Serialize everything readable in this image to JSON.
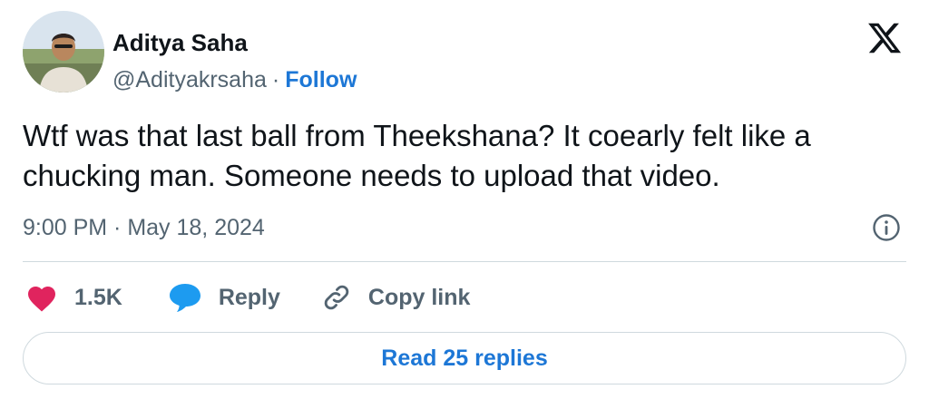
{
  "author": {
    "name": "Aditya Saha",
    "handle": "@Adityakrsaha",
    "separator": "·",
    "follow_label": "Follow"
  },
  "platform_icon": "x-logo-icon",
  "tweet": {
    "text": "Wtf was that last ball from Theekshana? It coearly felt like a chucking man. Someone needs to upload that video.",
    "timestamp": "9:00 PM · May 18, 2024"
  },
  "actions": {
    "like_count": "1.5K",
    "reply_label": "Reply",
    "copy_link_label": "Copy link"
  },
  "read_replies_label": "Read 25 replies",
  "colors": {
    "accent": "#1d77d6",
    "like": "#e0245e",
    "reply_bubble": "#1d9bf0",
    "secondary_text": "#536471"
  }
}
